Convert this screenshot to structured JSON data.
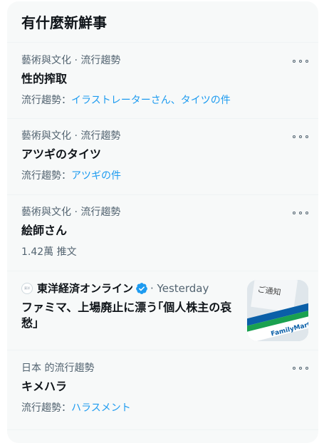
{
  "section_title": "有什麼新鮮事",
  "trends": [
    {
      "context": "藝術與文化 · 流行趨勢",
      "title": "性的搾取",
      "sub_prefix": "流行趨勢：",
      "sub_link": "イラストレーターさん、タイツの件"
    },
    {
      "context": "藝術與文化 · 流行趨勢",
      "title": "アツギのタイツ",
      "sub_prefix": "流行趨勢：",
      "sub_link": "アツギの件"
    },
    {
      "context": "藝術與文化 · 流行趨勢",
      "title": "絵師さん",
      "sub_text": "1.42萬 推文"
    }
  ],
  "news": {
    "logo_text": "東洋",
    "source": "東洋経済オンライン",
    "time": "· Yesterday",
    "title": "ファミマ、上場廃止に漂う｢個人株主の哀愁｣",
    "thumb_text_top": "ご通知",
    "thumb_text_brand": "FamilyMart",
    "colors": {
      "fm_blue": "#0a5fa8",
      "fm_green": "#1aa150"
    }
  },
  "trend_last": {
    "context": "日本 的流行趨勢",
    "title": "キメハラ",
    "sub_prefix": "流行趨勢：",
    "sub_link": "ハラスメント"
  },
  "colors": {
    "link": "#1d9bf0",
    "verified": "#1d9bf0"
  }
}
